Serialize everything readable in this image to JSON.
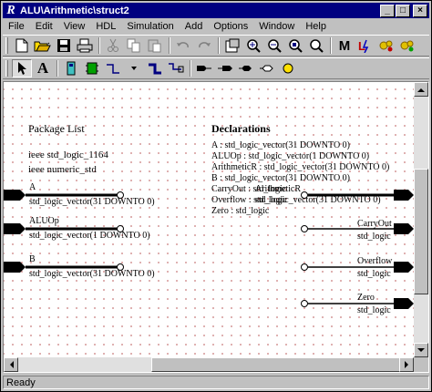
{
  "window": {
    "title": "ALU\\Arithmetic\\struct2",
    "controls": [
      "_",
      "□",
      "×"
    ]
  },
  "menu": [
    "File",
    "Edit",
    "View",
    "HDL",
    "Simulation",
    "Add",
    "Options",
    "Window",
    "Help"
  ],
  "toolbar1": [
    "new-icon",
    "open-icon",
    "save-icon",
    "print-icon",
    "cut-icon",
    "copy-icon",
    "paste-icon",
    "undo-icon",
    "redo-icon",
    "properties-icon",
    "zoom-in-icon",
    "zoom-out-icon",
    "zoom-fit-icon",
    "zoom-area-icon",
    "model-icon",
    "hdl-icon",
    "compile-icon",
    "simulate-icon"
  ],
  "toolbar2": [
    "select-arrow-icon",
    "text-icon",
    "block-icon",
    "component-icon",
    "wire-icon",
    "bus-icon",
    "ripper-icon",
    "port-in-icon",
    "port-out-icon",
    "port-inout-icon",
    "port-buffer-icon",
    "connector-icon"
  ],
  "diagram": {
    "package_list_title": "Package List",
    "packages": [
      "ieee std_logic_1164",
      "ieee numeric_std"
    ],
    "declarations_title": "Declarations",
    "declarations": [
      "A : std_logic_vector(31 DOWNTO 0)",
      "ALUOp : std_logic_vector(1 DOWNTO 0)",
      "ArithmeticR : std_logic_vector(31 DOWNTO 0)",
      "B : std_logic_vector(31 DOWNTO 0)",
      "CarryOut : std_logic",
      "Overflow : std_logic",
      "Zero : std_logic"
    ],
    "inputs": [
      {
        "name": "A",
        "type": "std_logic_vector(31 DOWNTO 0)"
      },
      {
        "name": "ALUOp",
        "type": "std_logic_vector(1 DOWNTO 0)"
      },
      {
        "name": "B",
        "type": "std_logic_vector(31 DOWNTO 0)"
      }
    ],
    "outputs": [
      {
        "name": "ArithmeticR",
        "type": "std_logic_vector(31 DOWNTO 0)"
      },
      {
        "name": "CarryOut",
        "type": "std_logic"
      },
      {
        "name": "Overflow",
        "type": "std_logic"
      },
      {
        "name": "Zero",
        "type": "std_logic"
      }
    ]
  },
  "status": "Ready"
}
